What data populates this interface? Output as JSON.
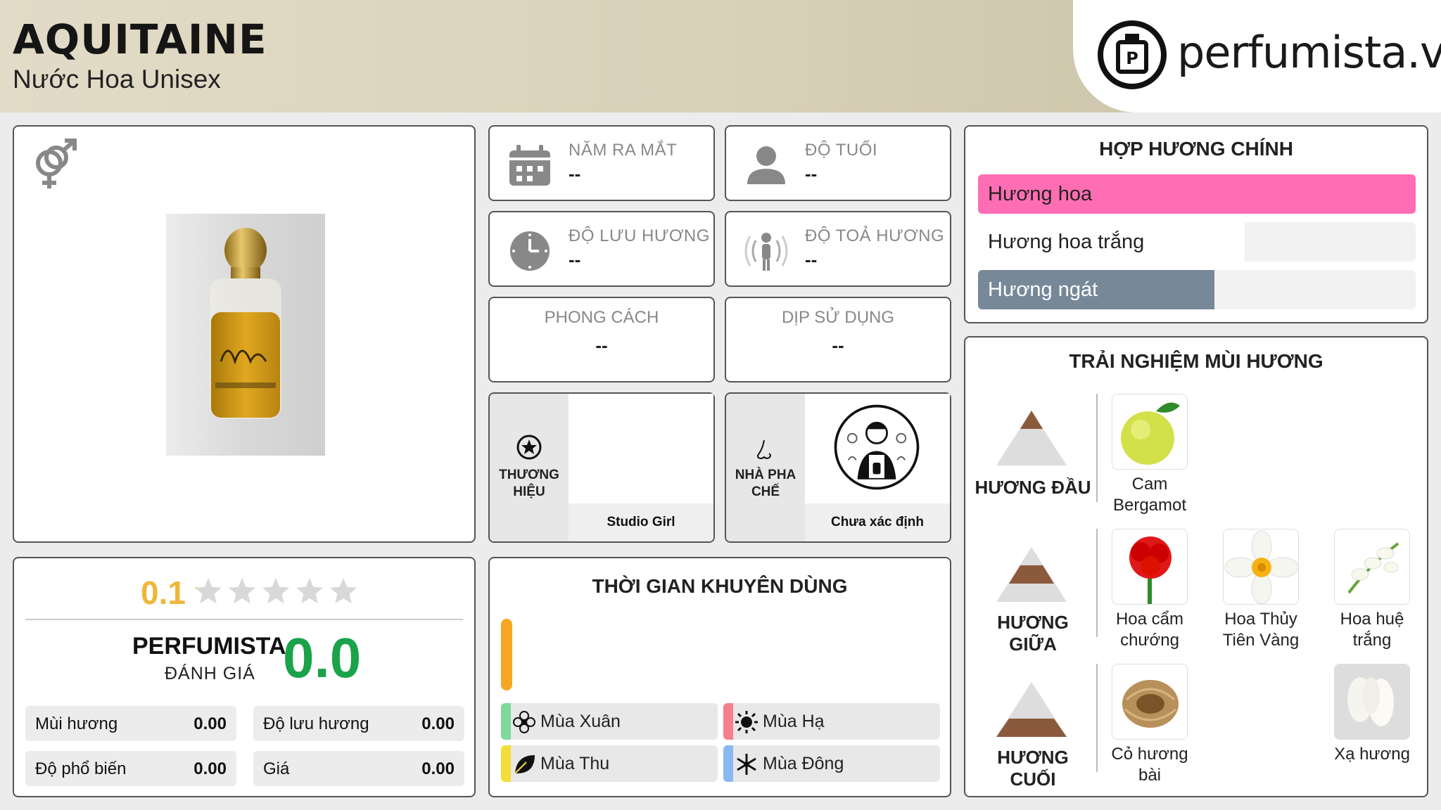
{
  "header": {
    "title": "AQUITAINE",
    "subtitle": "Nước Hoa Unisex",
    "brand": "perfumista.vn"
  },
  "info": {
    "release_year": {
      "label": "NĂM RA MẮT",
      "value": "--"
    },
    "age": {
      "label": "ĐỘ TUỔI",
      "value": "--"
    },
    "longevity": {
      "label": "ĐỘ LƯU HƯƠNG",
      "value": "--"
    },
    "sillage": {
      "label": "ĐỘ TOẢ HƯƠNG",
      "value": "--"
    },
    "style": {
      "label": "PHONG CÁCH",
      "value": "--"
    },
    "occasion": {
      "label": "DỊP SỬ DỤNG",
      "value": "--"
    },
    "brand": {
      "label_line1": "THƯƠNG",
      "label_line2": "HIỆU",
      "value": "Studio Girl"
    },
    "perfumer": {
      "label_line1": "NHÀ PHA",
      "label_line2": "CHẾ",
      "value": "Chưa xác định"
    }
  },
  "accords": {
    "title": "HỢP HƯƠNG CHÍNH",
    "items": [
      {
        "label": "Hương hoa",
        "level": 1.0,
        "color": "#ff6eb4",
        "text_color": "#222222"
      },
      {
        "label": "Hương hoa trắng",
        "level": 0.61,
        "color": "#ffffff",
        "text_color": "#222222"
      },
      {
        "label": "Hương ngát",
        "level": 0.54,
        "color": "#778899",
        "text_color": "#ffffff"
      }
    ]
  },
  "experience": {
    "title": "TRẢI NGHIỆM MÙI HƯƠNG",
    "top": {
      "label": "HƯƠNG ĐẦU",
      "notes": [
        {
          "name_line1": "Cam",
          "name_line2": "Bergamot"
        }
      ]
    },
    "middle": {
      "label": "HƯƠNG GIỮA",
      "notes": [
        {
          "name_line1": "Hoa cẩm",
          "name_line2": "chướng"
        },
        {
          "name_line1": "Hoa Thủy",
          "name_line2": "Tiên Vàng"
        },
        {
          "name_line1": "Hoa huệ",
          "name_line2": "trắng"
        }
      ]
    },
    "base": {
      "label": "HƯƠNG CUỐI",
      "notes": [
        {
          "name_line1": "Cỏ hương",
          "name_line2": "bài"
        },
        {
          "name_line1": "Xạ hương",
          "name_line2": ""
        }
      ]
    }
  },
  "rating": {
    "score": "0.1",
    "stars": 0.02,
    "perfumista_label": "PERFUMISTA",
    "perfumista_sub": "ĐÁNH GIÁ",
    "perfumista_score": "0.0",
    "metrics": [
      {
        "label": "Mùi hương",
        "value": "0.00"
      },
      {
        "label": "Độ lưu hương",
        "value": "0.00"
      },
      {
        "label": "Độ phổ biến",
        "value": "0.00"
      },
      {
        "label": "Giá",
        "value": "0.00"
      }
    ]
  },
  "time": {
    "title": "THỜI GIAN KHUYÊN DÙNG",
    "seasons": [
      {
        "label": "Mùa Xuân",
        "color": "#7ed99a"
      },
      {
        "label": "Mùa Hạ",
        "color": "#f5808a"
      },
      {
        "label": "Mùa Thu",
        "color": "#f5dc3b"
      },
      {
        "label": "Mùa Đông",
        "color": "#8ab8f0"
      }
    ]
  }
}
